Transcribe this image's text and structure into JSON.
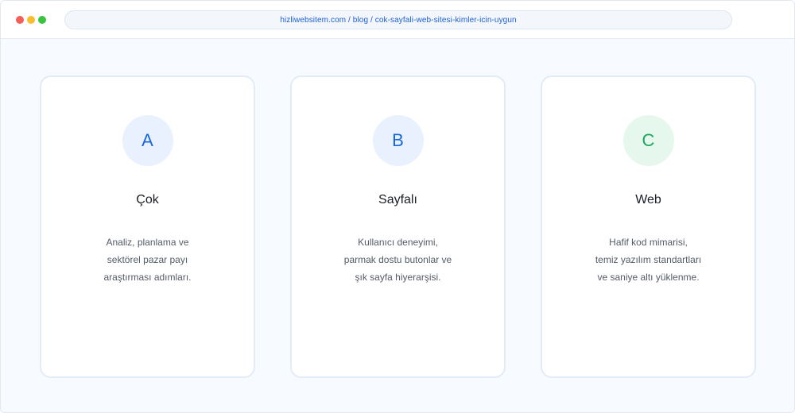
{
  "browser": {
    "url": "hizliwebsitem.com / blog / cok-sayfali-web-sitesi-kimler-icin-uygun"
  },
  "cards": [
    {
      "badge": "A",
      "title": "Çok",
      "lines": [
        "Analiz, planlama ve",
        "sektörel pazar payı",
        "araştırması adımları."
      ]
    },
    {
      "badge": "B",
      "title": "Sayfalı",
      "lines": [
        "Kullanıcı deneyimi,",
        "parmak dostu butonlar ve",
        "şık sayfa hiyerarşisi."
      ]
    },
    {
      "badge": "C",
      "title": "Web",
      "lines": [
        "Hafif kod mimarisi,",
        "temiz yazılım standartları",
        "ve saniye altı yüklenme."
      ]
    }
  ],
  "colors": {
    "accent_blue": "#1a67dc",
    "accent_green": "#1aa85a"
  }
}
